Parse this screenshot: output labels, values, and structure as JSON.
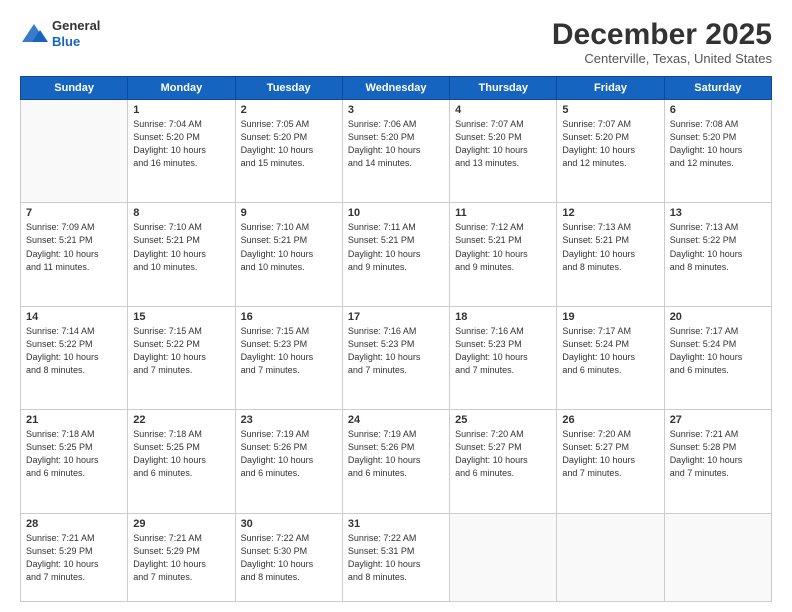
{
  "header": {
    "logo_line1": "General",
    "logo_line2": "Blue",
    "month": "December 2025",
    "location": "Centerville, Texas, United States"
  },
  "days_of_week": [
    "Sunday",
    "Monday",
    "Tuesday",
    "Wednesday",
    "Thursday",
    "Friday",
    "Saturday"
  ],
  "weeks": [
    [
      {
        "num": "",
        "info": ""
      },
      {
        "num": "1",
        "info": "Sunrise: 7:04 AM\nSunset: 5:20 PM\nDaylight: 10 hours\nand 16 minutes."
      },
      {
        "num": "2",
        "info": "Sunrise: 7:05 AM\nSunset: 5:20 PM\nDaylight: 10 hours\nand 15 minutes."
      },
      {
        "num": "3",
        "info": "Sunrise: 7:06 AM\nSunset: 5:20 PM\nDaylight: 10 hours\nand 14 minutes."
      },
      {
        "num": "4",
        "info": "Sunrise: 7:07 AM\nSunset: 5:20 PM\nDaylight: 10 hours\nand 13 minutes."
      },
      {
        "num": "5",
        "info": "Sunrise: 7:07 AM\nSunset: 5:20 PM\nDaylight: 10 hours\nand 12 minutes."
      },
      {
        "num": "6",
        "info": "Sunrise: 7:08 AM\nSunset: 5:20 PM\nDaylight: 10 hours\nand 12 minutes."
      }
    ],
    [
      {
        "num": "7",
        "info": "Sunrise: 7:09 AM\nSunset: 5:21 PM\nDaylight: 10 hours\nand 11 minutes."
      },
      {
        "num": "8",
        "info": "Sunrise: 7:10 AM\nSunset: 5:21 PM\nDaylight: 10 hours\nand 10 minutes."
      },
      {
        "num": "9",
        "info": "Sunrise: 7:10 AM\nSunset: 5:21 PM\nDaylight: 10 hours\nand 10 minutes."
      },
      {
        "num": "10",
        "info": "Sunrise: 7:11 AM\nSunset: 5:21 PM\nDaylight: 10 hours\nand 9 minutes."
      },
      {
        "num": "11",
        "info": "Sunrise: 7:12 AM\nSunset: 5:21 PM\nDaylight: 10 hours\nand 9 minutes."
      },
      {
        "num": "12",
        "info": "Sunrise: 7:13 AM\nSunset: 5:21 PM\nDaylight: 10 hours\nand 8 minutes."
      },
      {
        "num": "13",
        "info": "Sunrise: 7:13 AM\nSunset: 5:22 PM\nDaylight: 10 hours\nand 8 minutes."
      }
    ],
    [
      {
        "num": "14",
        "info": "Sunrise: 7:14 AM\nSunset: 5:22 PM\nDaylight: 10 hours\nand 8 minutes."
      },
      {
        "num": "15",
        "info": "Sunrise: 7:15 AM\nSunset: 5:22 PM\nDaylight: 10 hours\nand 7 minutes."
      },
      {
        "num": "16",
        "info": "Sunrise: 7:15 AM\nSunset: 5:23 PM\nDaylight: 10 hours\nand 7 minutes."
      },
      {
        "num": "17",
        "info": "Sunrise: 7:16 AM\nSunset: 5:23 PM\nDaylight: 10 hours\nand 7 minutes."
      },
      {
        "num": "18",
        "info": "Sunrise: 7:16 AM\nSunset: 5:23 PM\nDaylight: 10 hours\nand 7 minutes."
      },
      {
        "num": "19",
        "info": "Sunrise: 7:17 AM\nSunset: 5:24 PM\nDaylight: 10 hours\nand 6 minutes."
      },
      {
        "num": "20",
        "info": "Sunrise: 7:17 AM\nSunset: 5:24 PM\nDaylight: 10 hours\nand 6 minutes."
      }
    ],
    [
      {
        "num": "21",
        "info": "Sunrise: 7:18 AM\nSunset: 5:25 PM\nDaylight: 10 hours\nand 6 minutes."
      },
      {
        "num": "22",
        "info": "Sunrise: 7:18 AM\nSunset: 5:25 PM\nDaylight: 10 hours\nand 6 minutes."
      },
      {
        "num": "23",
        "info": "Sunrise: 7:19 AM\nSunset: 5:26 PM\nDaylight: 10 hours\nand 6 minutes."
      },
      {
        "num": "24",
        "info": "Sunrise: 7:19 AM\nSunset: 5:26 PM\nDaylight: 10 hours\nand 6 minutes."
      },
      {
        "num": "25",
        "info": "Sunrise: 7:20 AM\nSunset: 5:27 PM\nDaylight: 10 hours\nand 6 minutes."
      },
      {
        "num": "26",
        "info": "Sunrise: 7:20 AM\nSunset: 5:27 PM\nDaylight: 10 hours\nand 7 minutes."
      },
      {
        "num": "27",
        "info": "Sunrise: 7:21 AM\nSunset: 5:28 PM\nDaylight: 10 hours\nand 7 minutes."
      }
    ],
    [
      {
        "num": "28",
        "info": "Sunrise: 7:21 AM\nSunset: 5:29 PM\nDaylight: 10 hours\nand 7 minutes."
      },
      {
        "num": "29",
        "info": "Sunrise: 7:21 AM\nSunset: 5:29 PM\nDaylight: 10 hours\nand 7 minutes."
      },
      {
        "num": "30",
        "info": "Sunrise: 7:22 AM\nSunset: 5:30 PM\nDaylight: 10 hours\nand 8 minutes."
      },
      {
        "num": "31",
        "info": "Sunrise: 7:22 AM\nSunset: 5:31 PM\nDaylight: 10 hours\nand 8 minutes."
      },
      {
        "num": "",
        "info": ""
      },
      {
        "num": "",
        "info": ""
      },
      {
        "num": "",
        "info": ""
      }
    ]
  ]
}
